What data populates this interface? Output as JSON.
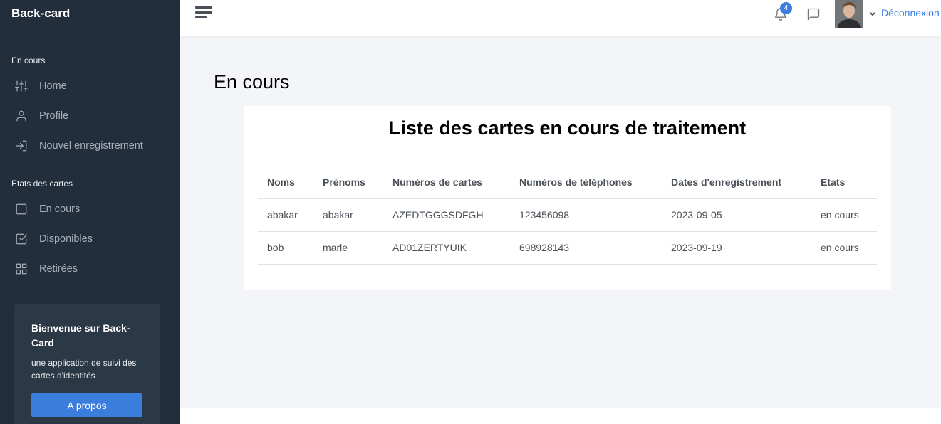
{
  "sidebar": {
    "brand": "Back-card",
    "sections": [
      {
        "title": "En cours",
        "items": [
          {
            "label": "Home",
            "icon": "sliders-icon"
          },
          {
            "label": "Profile",
            "icon": "user-icon"
          },
          {
            "label": "Nouvel enregistrement",
            "icon": "log-in-icon"
          }
        ]
      },
      {
        "title": "Etats des cartes",
        "items": [
          {
            "label": "En cours",
            "icon": "square-icon"
          },
          {
            "label": "Disponibles",
            "icon": "check-square-icon"
          },
          {
            "label": "Retirées",
            "icon": "grid-icon"
          }
        ]
      }
    ],
    "promo": {
      "title": "Bienvenue sur Back-Card",
      "text": "une application de suivi des cartes d'identités",
      "button": "A propos"
    }
  },
  "topbar": {
    "notification_count": "4",
    "logout_label": "Déconnexion"
  },
  "main": {
    "page_title": "En cours",
    "card_title": "Liste des cartes en cours de traitement",
    "table": {
      "columns": [
        "Noms",
        "Prénoms",
        "Numéros de cartes",
        "Numéros de téléphones",
        "Dates d'enregistrement",
        "Etats"
      ],
      "rows": [
        [
          "abakar",
          "abakar",
          "AZEDTGGGSDFGH",
          "123456098",
          "2023-09-05",
          "en cours"
        ],
        [
          "bob",
          "marle",
          "AD01ZERTYUIK",
          "698928143",
          "2023-09-19",
          "en cours"
        ]
      ]
    }
  },
  "colors": {
    "sidebar_bg": "#222e3c",
    "accent": "#3b7ddd",
    "page_bg": "#f4f5f8"
  }
}
